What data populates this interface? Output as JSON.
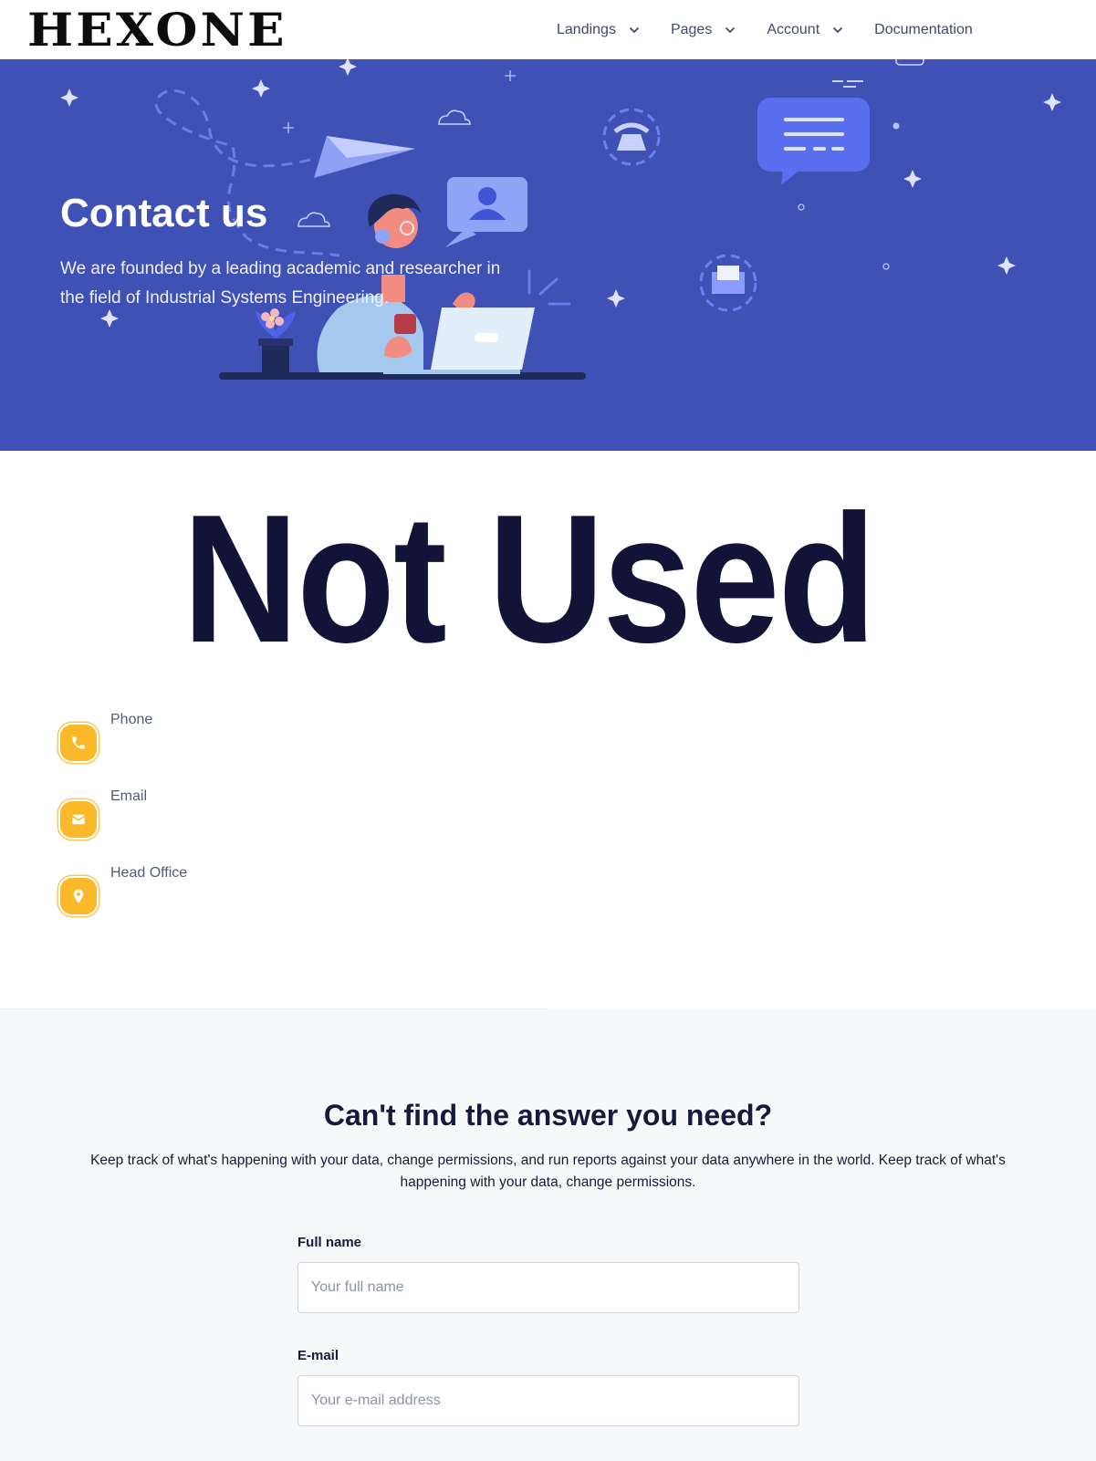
{
  "nav": {
    "logo": "HEXONE",
    "items": [
      {
        "label": "Landings",
        "has_dropdown": true
      },
      {
        "label": "Pages",
        "has_dropdown": true
      },
      {
        "label": "Account",
        "has_dropdown": true
      },
      {
        "label": "Documentation",
        "has_dropdown": false
      }
    ]
  },
  "hero": {
    "title": "Contact us",
    "text": "We are founded by a leading academic and researcher in the field of Industrial Systems Engineering.",
    "background": "#3f51b5"
  },
  "placeholder_banner": "Not Used",
  "contact": {
    "accent": "#fbb829",
    "items": [
      {
        "label": "Phone",
        "icon": "phone-icon"
      },
      {
        "label": "Email",
        "icon": "mail-icon"
      },
      {
        "label": "Head Office",
        "icon": "map-pin-icon"
      }
    ]
  },
  "faq": {
    "title": "Can't find the answer you need?",
    "text": "Keep track of what's happening with your data, change permissions, and run reports against your data anywhere in the world. Keep track of what's happening with your data, change permissions.",
    "fields": [
      {
        "label": "Full name",
        "placeholder": "Your full name"
      },
      {
        "label": "E-mail",
        "placeholder": "Your e-mail address"
      }
    ]
  }
}
